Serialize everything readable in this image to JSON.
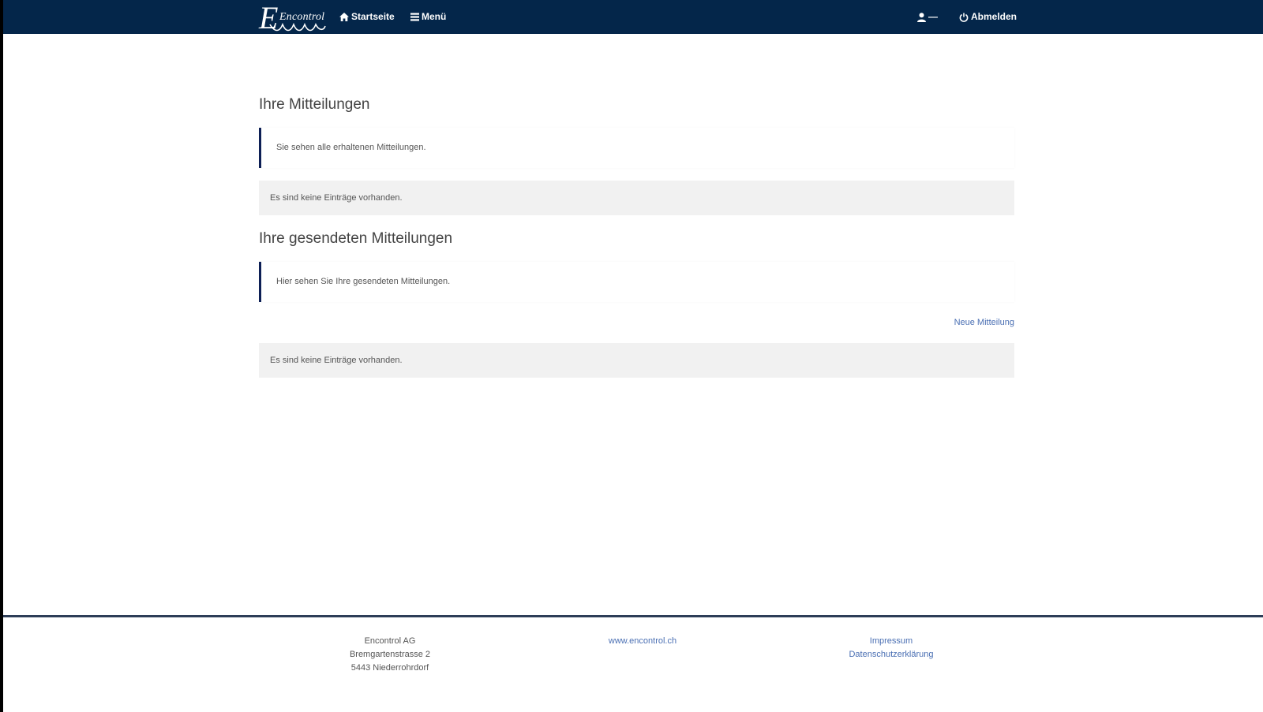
{
  "navbar": {
    "logo_text": "Encontrol",
    "logo_initial": "E",
    "home_label": "Startseite",
    "menu_label": "Menü",
    "user_label": "—",
    "logout_label": "Abmelden"
  },
  "received": {
    "title": "Ihre Mitteilungen",
    "info": "Sie sehen alle erhaltenen Mitteilungen.",
    "empty": "Es sind keine Einträge vorhanden."
  },
  "sent": {
    "title": "Ihre gesendeten Mitteilungen",
    "info": "Hier sehen Sie Ihre gesendeten Mitteilungen.",
    "new_link": "Neue Mitteilung",
    "empty": "Es sind keine Einträge vorhanden."
  },
  "footer": {
    "company": "Encontrol AG",
    "street": "Bremgartenstrasse 2",
    "city": "5443 Niederrohrdorf",
    "website": "www.encontrol.ch",
    "imprint": "Impressum",
    "privacy": "Datenschutzerklärung"
  },
  "colors": {
    "navbar_bg": "#04264a",
    "accent_border": "#0d1f55",
    "link": "#4a6fb3",
    "empty_bg": "#f1f1f1"
  }
}
